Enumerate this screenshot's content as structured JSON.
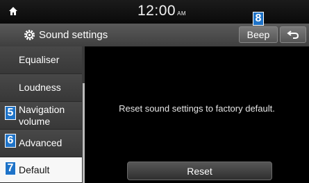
{
  "statusbar": {
    "time": "12:00",
    "ampm": "AM",
    "home_icon": "home-icon"
  },
  "titlebar": {
    "title": "Sound settings",
    "title_icon": "gear-icon",
    "beep_label": "Beep",
    "back_icon": "back-arrow-icon"
  },
  "sidebar": {
    "items": [
      {
        "label": "Equaliser"
      },
      {
        "label": "Loudness"
      },
      {
        "label": "Navigation volume"
      },
      {
        "label": "Advanced"
      },
      {
        "label": "Default",
        "selected": true
      }
    ]
  },
  "content": {
    "message": "Reset sound settings to factory default.",
    "reset_label": "Reset"
  },
  "callouts": {
    "beep": "8",
    "navigation": "5",
    "advanced": "6",
    "default": "7"
  },
  "colors": {
    "callout": "#1e73c8",
    "selected_bg": "#f7f7f7"
  }
}
